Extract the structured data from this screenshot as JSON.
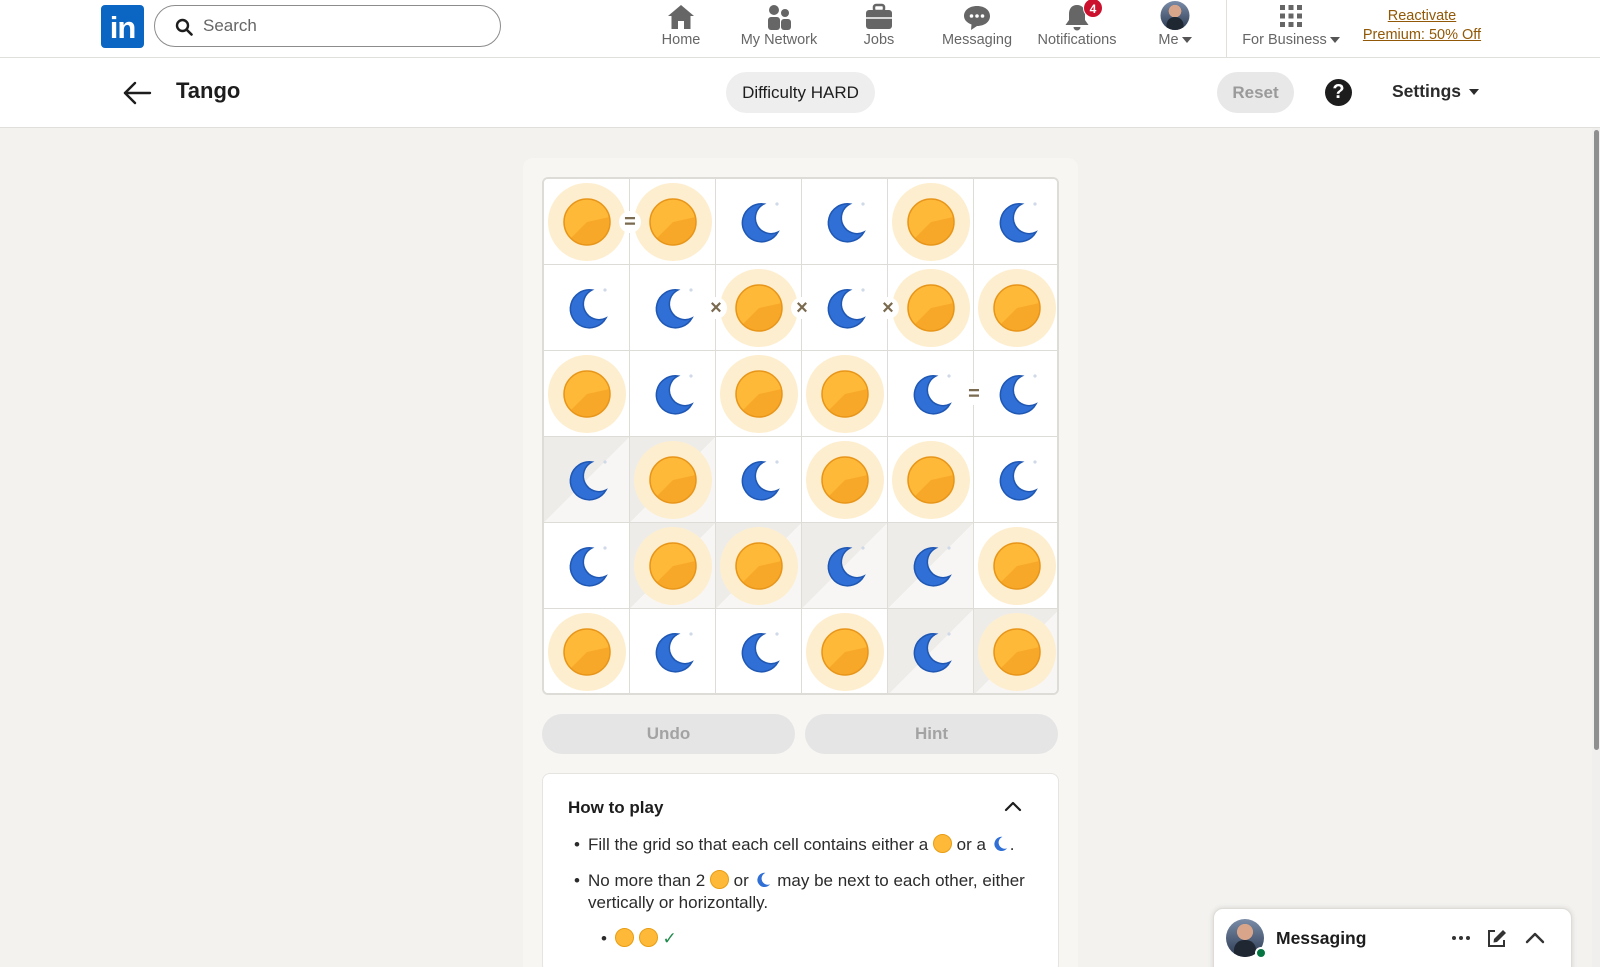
{
  "nav": {
    "search_placeholder": "Search",
    "items": [
      {
        "label": "Home",
        "icon": "home-icon"
      },
      {
        "label": "My Network",
        "icon": "network-icon"
      },
      {
        "label": "Jobs",
        "icon": "jobs-icon"
      },
      {
        "label": "Messaging",
        "icon": "messaging-icon"
      },
      {
        "label": "Notifications",
        "icon": "bell-icon",
        "badge": "4"
      },
      {
        "label": "Me",
        "icon": "avatar"
      },
      {
        "label": "For Business",
        "icon": "grid-icon"
      }
    ],
    "premium_line1": "Reactivate",
    "premium_line2": "Premium: 50% Off"
  },
  "header": {
    "title": "Tango",
    "difficulty": "Difficulty HARD",
    "reset_label": "Reset",
    "help_label": "?",
    "settings_label": "Settings"
  },
  "game": {
    "rows": 6,
    "cols": 6,
    "grid": [
      [
        "sun",
        "sun",
        "moon",
        "moon",
        "sun",
        "moon"
      ],
      [
        "moon",
        "moon",
        "sun",
        "moon",
        "sun",
        "sun"
      ],
      [
        "sun",
        "moon",
        "sun",
        "sun",
        "moon",
        "moon"
      ],
      [
        "moon",
        "sun",
        "moon",
        "sun",
        "sun",
        "moon"
      ],
      [
        "moon",
        "sun",
        "sun",
        "moon",
        "moon",
        "sun"
      ],
      [
        "sun",
        "moon",
        "moon",
        "sun",
        "moon",
        "sun"
      ]
    ],
    "prefilled": [
      [
        false,
        false,
        false,
        false,
        false,
        false
      ],
      [
        false,
        false,
        false,
        false,
        false,
        false
      ],
      [
        false,
        false,
        false,
        false,
        false,
        false
      ],
      [
        true,
        true,
        false,
        false,
        false,
        false
      ],
      [
        false,
        true,
        true,
        true,
        true,
        false
      ],
      [
        false,
        false,
        false,
        false,
        true,
        true
      ]
    ],
    "constraints": [
      {
        "row": 0,
        "col": 0,
        "dir": "right",
        "symbol": "="
      },
      {
        "row": 1,
        "col": 1,
        "dir": "right",
        "symbol": "×"
      },
      {
        "row": 1,
        "col": 2,
        "dir": "right",
        "symbol": "×"
      },
      {
        "row": 1,
        "col": 3,
        "dir": "right",
        "symbol": "×"
      },
      {
        "row": 2,
        "col": 4,
        "dir": "right",
        "symbol": "="
      }
    ],
    "undo_label": "Undo",
    "hint_label": "Hint"
  },
  "howto": {
    "title": "How to play",
    "rule1_a": "Fill the grid so that each cell contains either a",
    "rule1_b": "or a",
    "rule1_c": ".",
    "rule2_a": "No more than 2",
    "rule2_b": "or",
    "rule2_c": "may be next to each other, either vertically or horizontally.",
    "example_mark": "✓"
  },
  "dock": {
    "title": "Messaging"
  },
  "colors": {
    "brand": "#0a66c2",
    "sun": "#ffb938",
    "moon": "#2f6fd6",
    "badge": "#cb112d",
    "premium": "#915907"
  }
}
